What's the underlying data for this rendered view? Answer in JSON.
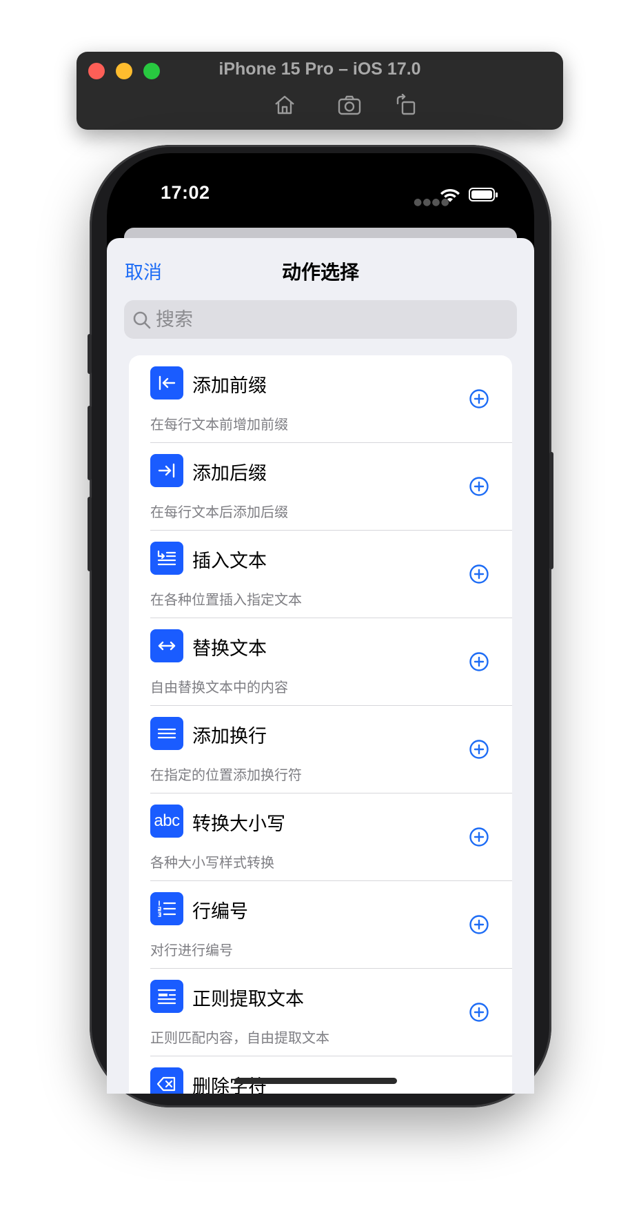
{
  "simulator": {
    "title": "iPhone 15 Pro – iOS 17.0",
    "tools": [
      "home-icon",
      "screenshot-icon",
      "rotate-icon"
    ]
  },
  "status_bar": {
    "time": "17:02",
    "icons": [
      "cellular-icon",
      "wifi-icon",
      "battery-icon"
    ]
  },
  "sheet": {
    "cancel_label": "取消",
    "title": "动作选择",
    "search_placeholder": "搜索"
  },
  "actions": [
    {
      "title": "添加前缀",
      "subtitle": "在每行文本前增加前缀",
      "icon": "arrow-to-left-bar-icon"
    },
    {
      "title": "添加后缀",
      "subtitle": "在每行文本后添加后缀",
      "icon": "arrow-to-right-bar-icon"
    },
    {
      "title": "插入文本",
      "subtitle": "在各种位置插入指定文本",
      "icon": "insert-text-icon"
    },
    {
      "title": "替换文本",
      "subtitle": "自由替换文本中的内容",
      "icon": "left-right-arrow-icon"
    },
    {
      "title": "添加换行",
      "subtitle": "在指定的位置添加换行符",
      "icon": "lines-icon"
    },
    {
      "title": "转换大小写",
      "subtitle": "各种大小写样式转换",
      "icon": "abc-icon",
      "icon_text": "abc"
    },
    {
      "title": "行编号",
      "subtitle": "对行进行编号",
      "icon": "numbered-list-icon"
    },
    {
      "title": "正则提取文本",
      "subtitle": "正则匹配内容，自由提取文本",
      "icon": "text-extract-icon"
    },
    {
      "title": "删除字符",
      "subtitle": "",
      "icon": "delete-left-icon"
    }
  ],
  "colors": {
    "accent": "#1d6cf5",
    "icon_bg": "#1a5cff",
    "sheet_bg": "#eff0f5"
  }
}
